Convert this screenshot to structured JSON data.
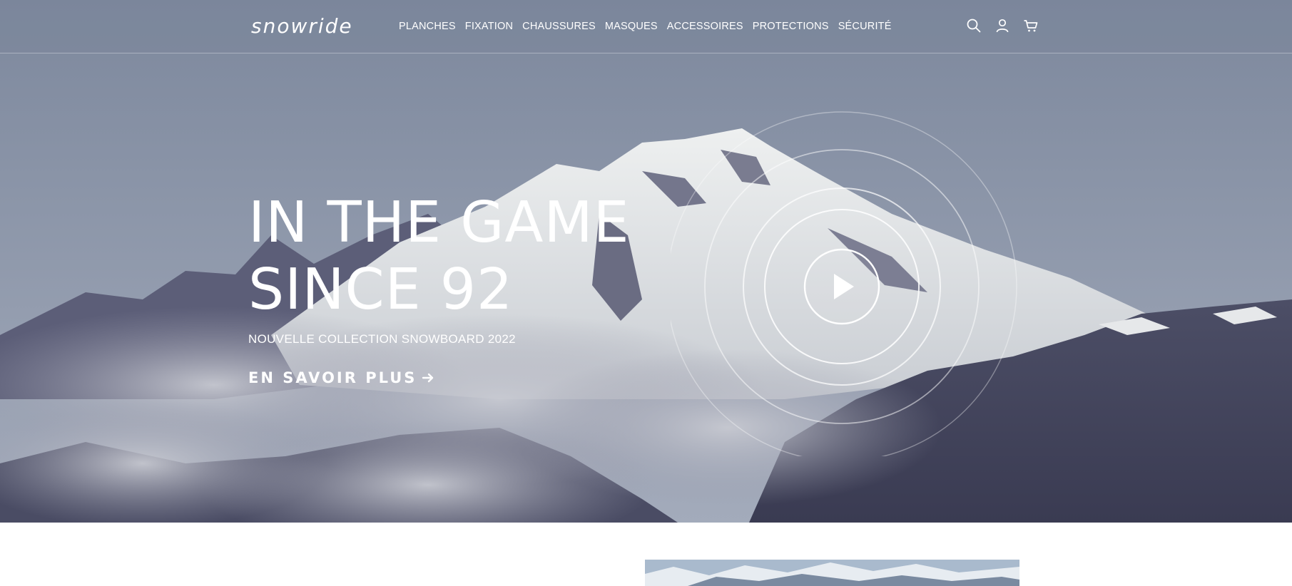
{
  "brand": {
    "logo_text": "snowride"
  },
  "nav": {
    "items": [
      {
        "label": "PLANCHES"
      },
      {
        "label": "FIXATION"
      },
      {
        "label": "CHAUSSURES"
      },
      {
        "label": "MASQUES"
      },
      {
        "label": "ACCESSOIRES"
      },
      {
        "label": "PROTECTIONS"
      },
      {
        "label": "SÉCURITÉ"
      }
    ]
  },
  "header_icons": [
    "search-icon",
    "user-icon",
    "cart-icon"
  ],
  "hero": {
    "headline_line1": "IN THE GAME",
    "headline_line2": "SINCE 92",
    "subtitle": "NOUVELLE COLLECTION SNOWBOARD 2022",
    "cta_label": "EN SAVOIR PLUS",
    "cta_icon": "arrow-right-icon",
    "play_icon": "play-icon"
  },
  "colors": {
    "hero_tint": "#8d97aa",
    "text": "#ffffff"
  }
}
